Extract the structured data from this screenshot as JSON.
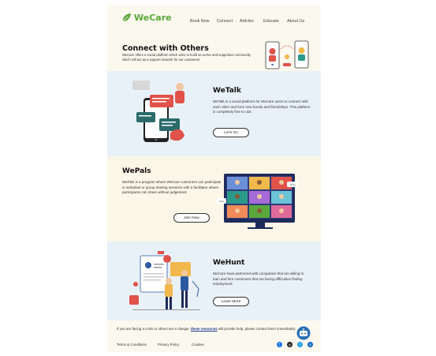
{
  "brand": {
    "name": "WeCare",
    "color": "#5aa83c"
  },
  "nav": [
    {
      "label": "Book Now"
    },
    {
      "label": "Connect"
    },
    {
      "label": "Articles"
    },
    {
      "label": "Educate"
    },
    {
      "label": "About Us"
    }
  ],
  "intro": {
    "title": "Connect with Others",
    "text": "WeCare offers a social platform which aims to build an active and supportive community which will act as a support network for our customers"
  },
  "sections": {
    "wetalk": {
      "title": "WeTalk",
      "text": "WeTalk is a social platform for WeCare users to connect with each other and form new bonds and friendships. This platform is completely free to use.",
      "button": "Let's Go",
      "bg": "#e9f1f8"
    },
    "wepals": {
      "title": "WePals",
      "text": "WePals is a program where WeCare customers can participate in individual or group sharing sessions with a facilitator where participants can share without judgement",
      "button": "Join Now",
      "bg": "#fbf6e7",
      "bubbles": [
        "hello",
        "hello"
      ]
    },
    "wehunt": {
      "title": "WeHunt",
      "text": "WeCare have partnered with companies that are willing to train and hire customers that are facing difficulties finding employment.",
      "button": "Learn More",
      "bg": "#e9f1f8"
    }
  },
  "footer": {
    "text_before": "If you are facing a crisis or others are in danger,",
    "link": "these resources",
    "text_after": "will provide help, please contact them immediately.",
    "links": [
      "Terms & Conditions",
      "Privacy Policy",
      "Cookies"
    ],
    "social": [
      {
        "icon": "facebook-icon",
        "color": "#1877f2"
      },
      {
        "icon": "instagram-icon",
        "color": "#222222"
      },
      {
        "icon": "twitter-icon",
        "color": "#1da1f2"
      },
      {
        "icon": "linkedin-icon",
        "color": "#0a66c2"
      }
    ]
  }
}
